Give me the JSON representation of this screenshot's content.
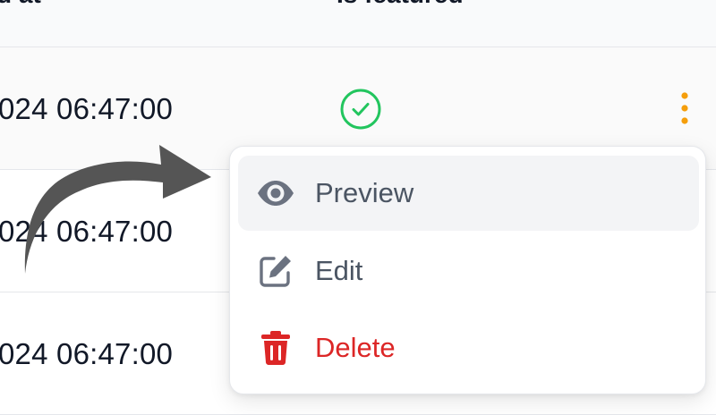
{
  "table": {
    "columns": [
      {
        "label": "d at"
      },
      {
        "label": "Is featured"
      }
    ],
    "rows": [
      {
        "date": "024 06:47:00",
        "featured": true
      },
      {
        "date": "024 06:47:00",
        "featured": false
      },
      {
        "date": "024 06:47:00",
        "featured": false
      }
    ]
  },
  "menu": {
    "items": [
      {
        "label": "Preview",
        "icon": "eye-icon",
        "tone": "default"
      },
      {
        "label": "Edit",
        "icon": "pencil-square-icon",
        "tone": "default"
      },
      {
        "label": "Delete",
        "icon": "trash-icon",
        "tone": "danger"
      }
    ]
  },
  "colors": {
    "success": "#22c55e",
    "warning": "#f59e0b",
    "danger": "#dc2626",
    "muted_icon": "#6b7280",
    "arrow": "#555555"
  }
}
